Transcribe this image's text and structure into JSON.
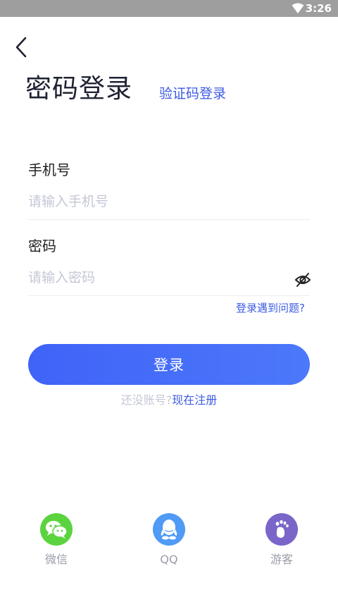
{
  "status_bar": {
    "time": "3:26"
  },
  "header": {
    "title": "密码登录",
    "switch_link": "验证码登录"
  },
  "form": {
    "phone_label": "手机号",
    "phone_placeholder": "请输入手机号",
    "phone_value": "",
    "password_label": "密码",
    "password_placeholder": "请输入密码",
    "password_value": "",
    "problem_link": "登录遇到问题?"
  },
  "login_button": "登录",
  "register": {
    "prompt": "还没账号?",
    "link": "现在注册"
  },
  "social": [
    {
      "label": "微信",
      "icon": "wechat-icon",
      "color": "#5bd33f"
    },
    {
      "label": "QQ",
      "icon": "qq-icon",
      "color": "#4f9bf5"
    },
    {
      "label": "游客",
      "icon": "footprint-icon",
      "color": "#7a66c9"
    }
  ],
  "colors": {
    "accent": "#3b5be3",
    "button": "#4570f9"
  }
}
